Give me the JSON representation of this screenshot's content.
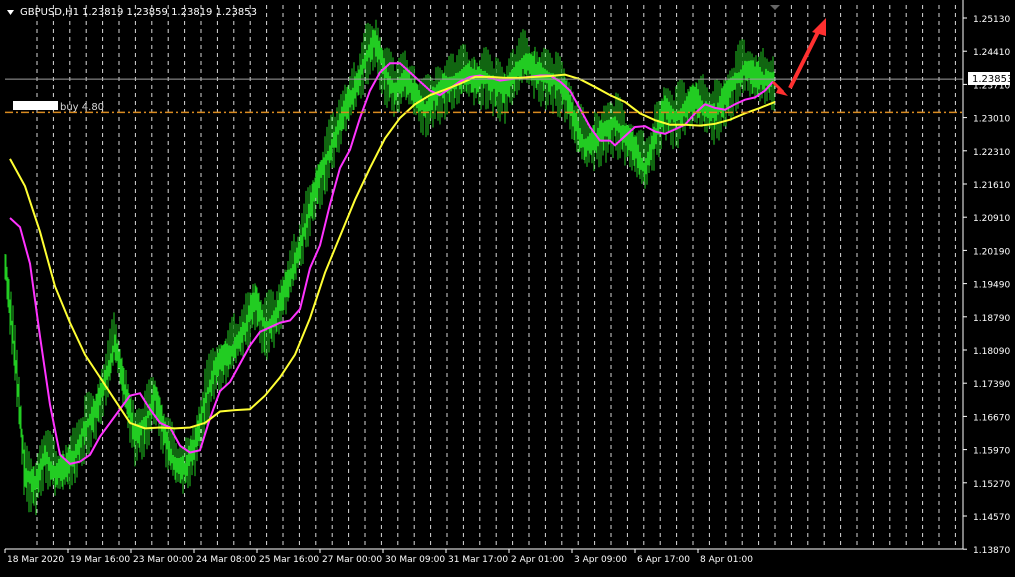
{
  "header": {
    "symbol": "GBPUSD,H1",
    "ohlc": "1.23819 1.23859 1.23819 1.23853"
  },
  "order_label": "buy 4.80",
  "current_price": "1.23853",
  "colors": {
    "background": "#000000",
    "candles": "#22cc22",
    "ma_fast": "#ff33ff",
    "ma_slow": "#ffff33",
    "order_line": "#d98a1f",
    "grid": "#ffffff",
    "price_box": "#ffffff",
    "arrow": "#ff3030",
    "axis_text": "#ffffff"
  },
  "chart_data": {
    "type": "line",
    "xlabel": "",
    "ylabel": "",
    "ylim": [
      1.1353,
      1.2548
    ],
    "grid": true,
    "grid_style": "vertical dashed",
    "price_ticks": [
      "1.25130",
      "1.24410",
      "1.23710",
      "1.23010",
      "1.22310",
      "1.21610",
      "1.20910",
      "1.20190",
      "1.19490",
      "1.18790",
      "1.18090",
      "1.17390",
      "1.16670",
      "1.15970",
      "1.15270",
      "1.14570",
      "1.13870"
    ],
    "time_ticks": [
      "18 Mar 2020",
      "19 Mar 16:00",
      "23 Mar 00:00",
      "24 Mar 08:00",
      "25 Mar 16:00",
      "27 Mar 00:00",
      "30 Mar 09:00",
      "31 Mar 17:00",
      "2 Apr 01:00",
      "3 Apr 09:00",
      "6 Apr 17:00",
      "8 Apr 01:00"
    ],
    "current_price": 1.23853,
    "order_level": 1.2312,
    "series": [
      {
        "kind": "price_bars",
        "x": [
          0,
          10,
          20,
          30,
          40,
          50,
          60,
          70,
          80,
          90,
          100,
          110,
          120,
          130,
          140,
          150,
          160,
          170,
          180,
          190,
          200,
          210,
          220,
          230,
          240,
          250,
          260,
          270,
          280,
          290,
          300,
          310,
          320,
          330,
          340,
          350,
          360,
          370,
          380,
          390,
          400,
          410,
          420,
          430,
          440,
          450,
          460,
          470,
          480,
          490,
          500,
          510,
          520,
          530,
          540,
          550,
          560,
          570,
          580,
          590,
          600,
          610,
          620,
          630,
          640,
          650,
          660,
          670,
          680,
          690,
          700,
          710,
          720,
          730,
          740,
          750,
          760
        ],
        "values": [
          1.198,
          1.178,
          1.152,
          1.149,
          1.156,
          1.152,
          1.153,
          1.156,
          1.162,
          1.165,
          1.172,
          1.181,
          1.17,
          1.16,
          1.163,
          1.169,
          1.16,
          1.154,
          1.153,
          1.158,
          1.168,
          1.175,
          1.177,
          1.18,
          1.184,
          1.19,
          1.184,
          1.186,
          1.192,
          1.198,
          1.206,
          1.214,
          1.22,
          1.226,
          1.232,
          1.236,
          1.243,
          1.247,
          1.24,
          1.236,
          1.239,
          1.235,
          1.232,
          1.235,
          1.237,
          1.238,
          1.24,
          1.238,
          1.239,
          1.237,
          1.236,
          1.24,
          1.243,
          1.24,
          1.239,
          1.238,
          1.236,
          1.229,
          1.224,
          1.225,
          1.227,
          1.229,
          1.226,
          1.223,
          1.219,
          1.226,
          1.232,
          1.23,
          1.232,
          1.234,
          1.232,
          1.231,
          1.234,
          1.238,
          1.241,
          1.239,
          1.2385
        ]
      },
      {
        "kind": "moving_average",
        "color_key": "ma_fast",
        "x": [
          5,
          15,
          25,
          35,
          45,
          55,
          65,
          75,
          85,
          95,
          105,
          115,
          125,
          135,
          145,
          155,
          165,
          175,
          185,
          195,
          205,
          215,
          225,
          235,
          245,
          255,
          265,
          275,
          285,
          295,
          305,
          315,
          325,
          335,
          345,
          355,
          365,
          375,
          385,
          395,
          405,
          415,
          425,
          435,
          445,
          455,
          465,
          475,
          485,
          495,
          505,
          515,
          525,
          535,
          545,
          555,
          565,
          575,
          585,
          595,
          605,
          610,
          620,
          630,
          640,
          650,
          660,
          670,
          680,
          690,
          700,
          710,
          720,
          730,
          740,
          750,
          760,
          768
        ],
        "values": [
          1.208,
          1.206,
          1.198,
          1.182,
          1.167,
          1.156,
          1.154,
          1.1545,
          1.156,
          1.16,
          1.163,
          1.166,
          1.169,
          1.1695,
          1.166,
          1.163,
          1.162,
          1.158,
          1.1565,
          1.157,
          1.164,
          1.17,
          1.172,
          1.176,
          1.18,
          1.183,
          1.184,
          1.185,
          1.1855,
          1.188,
          1.197,
          1.202,
          1.211,
          1.219,
          1.223,
          1.23,
          1.236,
          1.24,
          1.242,
          1.242,
          1.24,
          1.238,
          1.236,
          1.235,
          1.2365,
          1.238,
          1.239,
          1.2393,
          1.2388,
          1.2382,
          1.2385,
          1.2388,
          1.239,
          1.2393,
          1.2393,
          1.238,
          1.236,
          1.232,
          1.228,
          1.225,
          1.225,
          1.224,
          1.226,
          1.228,
          1.2282,
          1.227,
          1.2265,
          1.2275,
          1.2285,
          1.231,
          1.233,
          1.2322,
          1.2318,
          1.233,
          1.234,
          1.2345,
          1.236,
          1.238
        ]
      },
      {
        "kind": "moving_average",
        "color_key": "ma_slow",
        "x": [
          5,
          20,
          35,
          50,
          65,
          80,
          95,
          110,
          125,
          140,
          155,
          170,
          185,
          200,
          215,
          230,
          245,
          260,
          275,
          290,
          305,
          320,
          335,
          350,
          365,
          380,
          395,
          410,
          425,
          440,
          455,
          470,
          485,
          500,
          515,
          530,
          545,
          560,
          575,
          590,
          605,
          620,
          635,
          650,
          665,
          680,
          695,
          710,
          725,
          740,
          755,
          770
        ],
        "values": [
          1.221,
          1.215,
          1.205,
          1.193,
          1.185,
          1.178,
          1.173,
          1.168,
          1.163,
          1.1618,
          1.162,
          1.1618,
          1.162,
          1.163,
          1.1655,
          1.1658,
          1.166,
          1.169,
          1.173,
          1.178,
          1.186,
          1.196,
          1.204,
          1.212,
          1.219,
          1.2255,
          1.23,
          1.233,
          1.235,
          1.2362,
          1.2375,
          1.239,
          1.239,
          1.2388,
          1.2388,
          1.239,
          1.2392,
          1.2395,
          1.2385,
          1.2368,
          1.235,
          1.2335,
          1.231,
          1.2295,
          1.2285,
          1.2285,
          1.2283,
          1.2287,
          1.2296,
          1.231,
          1.2322,
          1.2335
        ]
      }
    ]
  }
}
